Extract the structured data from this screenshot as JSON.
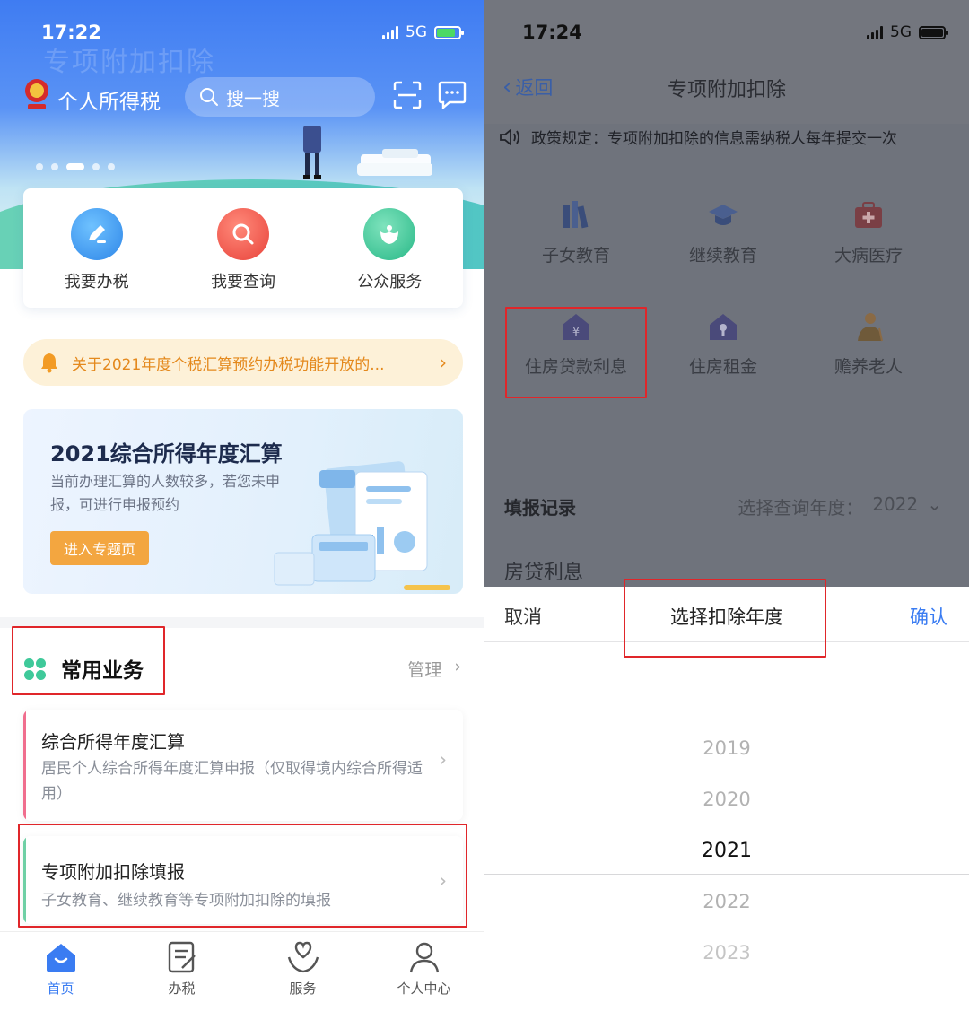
{
  "left": {
    "status": {
      "time": "17:22",
      "network": "5G"
    },
    "hero_bg_title": "专项附加扣除",
    "header": {
      "app_title": "个人所得税",
      "search_placeholder": "搜一搜"
    },
    "quick_actions": [
      {
        "label": "我要办税",
        "icon": "edit-icon",
        "color": "#3a9cf0"
      },
      {
        "label": "我要查询",
        "icon": "magnifier-icon",
        "color": "#f0524a"
      },
      {
        "label": "公众服务",
        "icon": "service-icon",
        "color": "#35c79a"
      }
    ],
    "notice": "关于2021年度个税汇算预约办税功能开放的...",
    "banner": {
      "title": "2021综合所得年度汇算",
      "desc": "当前办理汇算的人数较多，若您未申报，可进行申报预约",
      "button": "进入专题页"
    },
    "common": {
      "title": "常用业务",
      "manage": "管理"
    },
    "cards": [
      {
        "title": "综合所得年度汇算",
        "desc": "居民个人综合所得年度汇算申报（仅取得境内综合所得适用）",
        "accent": "#f06e8e"
      },
      {
        "title": "专项附加扣除填报",
        "desc": "子女教育、继续教育等专项附加扣除的填报",
        "accent": "#6fd0a5"
      }
    ],
    "tabs": [
      {
        "label": "首页",
        "icon": "home-icon"
      },
      {
        "label": "办税",
        "icon": "document-icon"
      },
      {
        "label": "服务",
        "icon": "heart-hands-icon"
      },
      {
        "label": "个人中心",
        "icon": "person-icon"
      }
    ]
  },
  "right": {
    "status": {
      "time": "17:24",
      "network": "5G"
    },
    "nav": {
      "back": "返回",
      "title": "专项附加扣除"
    },
    "policy": "政策规定：专项附加扣除的信息需纳税人每年提交一次",
    "categories": [
      {
        "label": "子女教育",
        "icon": "books-icon"
      },
      {
        "label": "继续教育",
        "icon": "graduation-cap-icon"
      },
      {
        "label": "大病医疗",
        "icon": "medical-kit-icon"
      },
      {
        "label": "住房贷款利息",
        "icon": "house-yuan-icon"
      },
      {
        "label": "住房租金",
        "icon": "house-key-icon"
      },
      {
        "label": "赡养老人",
        "icon": "elder-icon"
      }
    ],
    "records": {
      "title": "填报记录",
      "year_label": "选择查询年度：",
      "year": "2022"
    },
    "loan_title": "房贷利息",
    "sheet": {
      "cancel": "取消",
      "title": "选择扣除年度",
      "confirm": "确认"
    },
    "years": [
      "2019",
      "2020",
      "2021",
      "2022",
      "2023"
    ],
    "selected_year": "2021"
  }
}
